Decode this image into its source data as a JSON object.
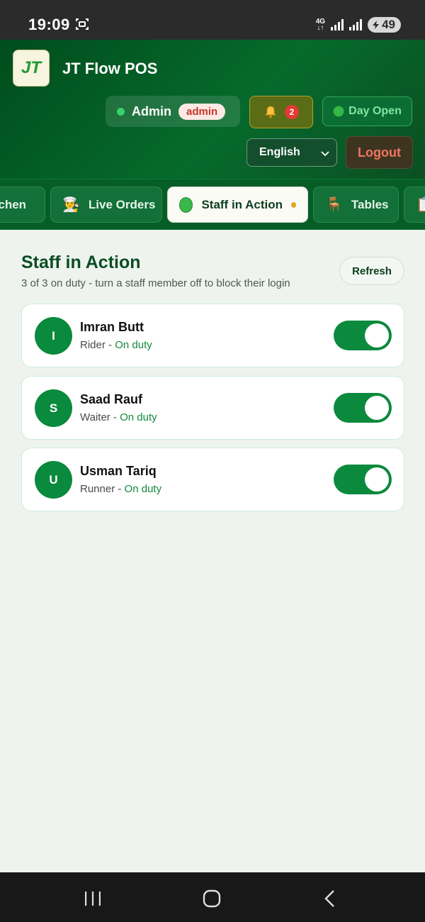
{
  "status_bar": {
    "time": "19:09",
    "network": "4G",
    "battery": "49",
    "icons": [
      "screen-record-icon",
      "signal-icon",
      "signal-icon",
      "battery-icon"
    ]
  },
  "header": {
    "logo_text": "JT",
    "app_title": "JT Flow POS",
    "user_name": "Admin",
    "user_role": "admin",
    "notification_count": "2",
    "day_status": "Day Open",
    "language": "English",
    "logout_label": "Logout"
  },
  "tabs": [
    {
      "label": "itchen",
      "icon": "chef-icon"
    },
    {
      "label": "Live Orders",
      "icon": "cook-icon"
    },
    {
      "label": "Staff in Action",
      "icon": "green-circle-icon",
      "active": true
    },
    {
      "label": "Tables",
      "icon": "chair-icon"
    },
    {
      "label": "",
      "icon": "clipboard-icon"
    }
  ],
  "main": {
    "title": "Staff in Action",
    "subtitle": "3 of 3 on duty - turn a staff member off to block their login",
    "refresh_label": "Refresh",
    "staff": [
      {
        "initial": "I",
        "name": "Imran Butt",
        "role": "Rider",
        "status": "On duty",
        "on": true
      },
      {
        "initial": "S",
        "name": "Saad Rauf",
        "role": "Waiter",
        "status": "On duty",
        "on": true
      },
      {
        "initial": "U",
        "name": "Usman Tariq",
        "role": "Runner",
        "status": "On duty",
        "on": true
      }
    ]
  },
  "colors": {
    "header_green": "#066a2c",
    "accent_green": "#0b8a3d",
    "badge_red": "#e53935",
    "logout_text": "#f07560"
  }
}
